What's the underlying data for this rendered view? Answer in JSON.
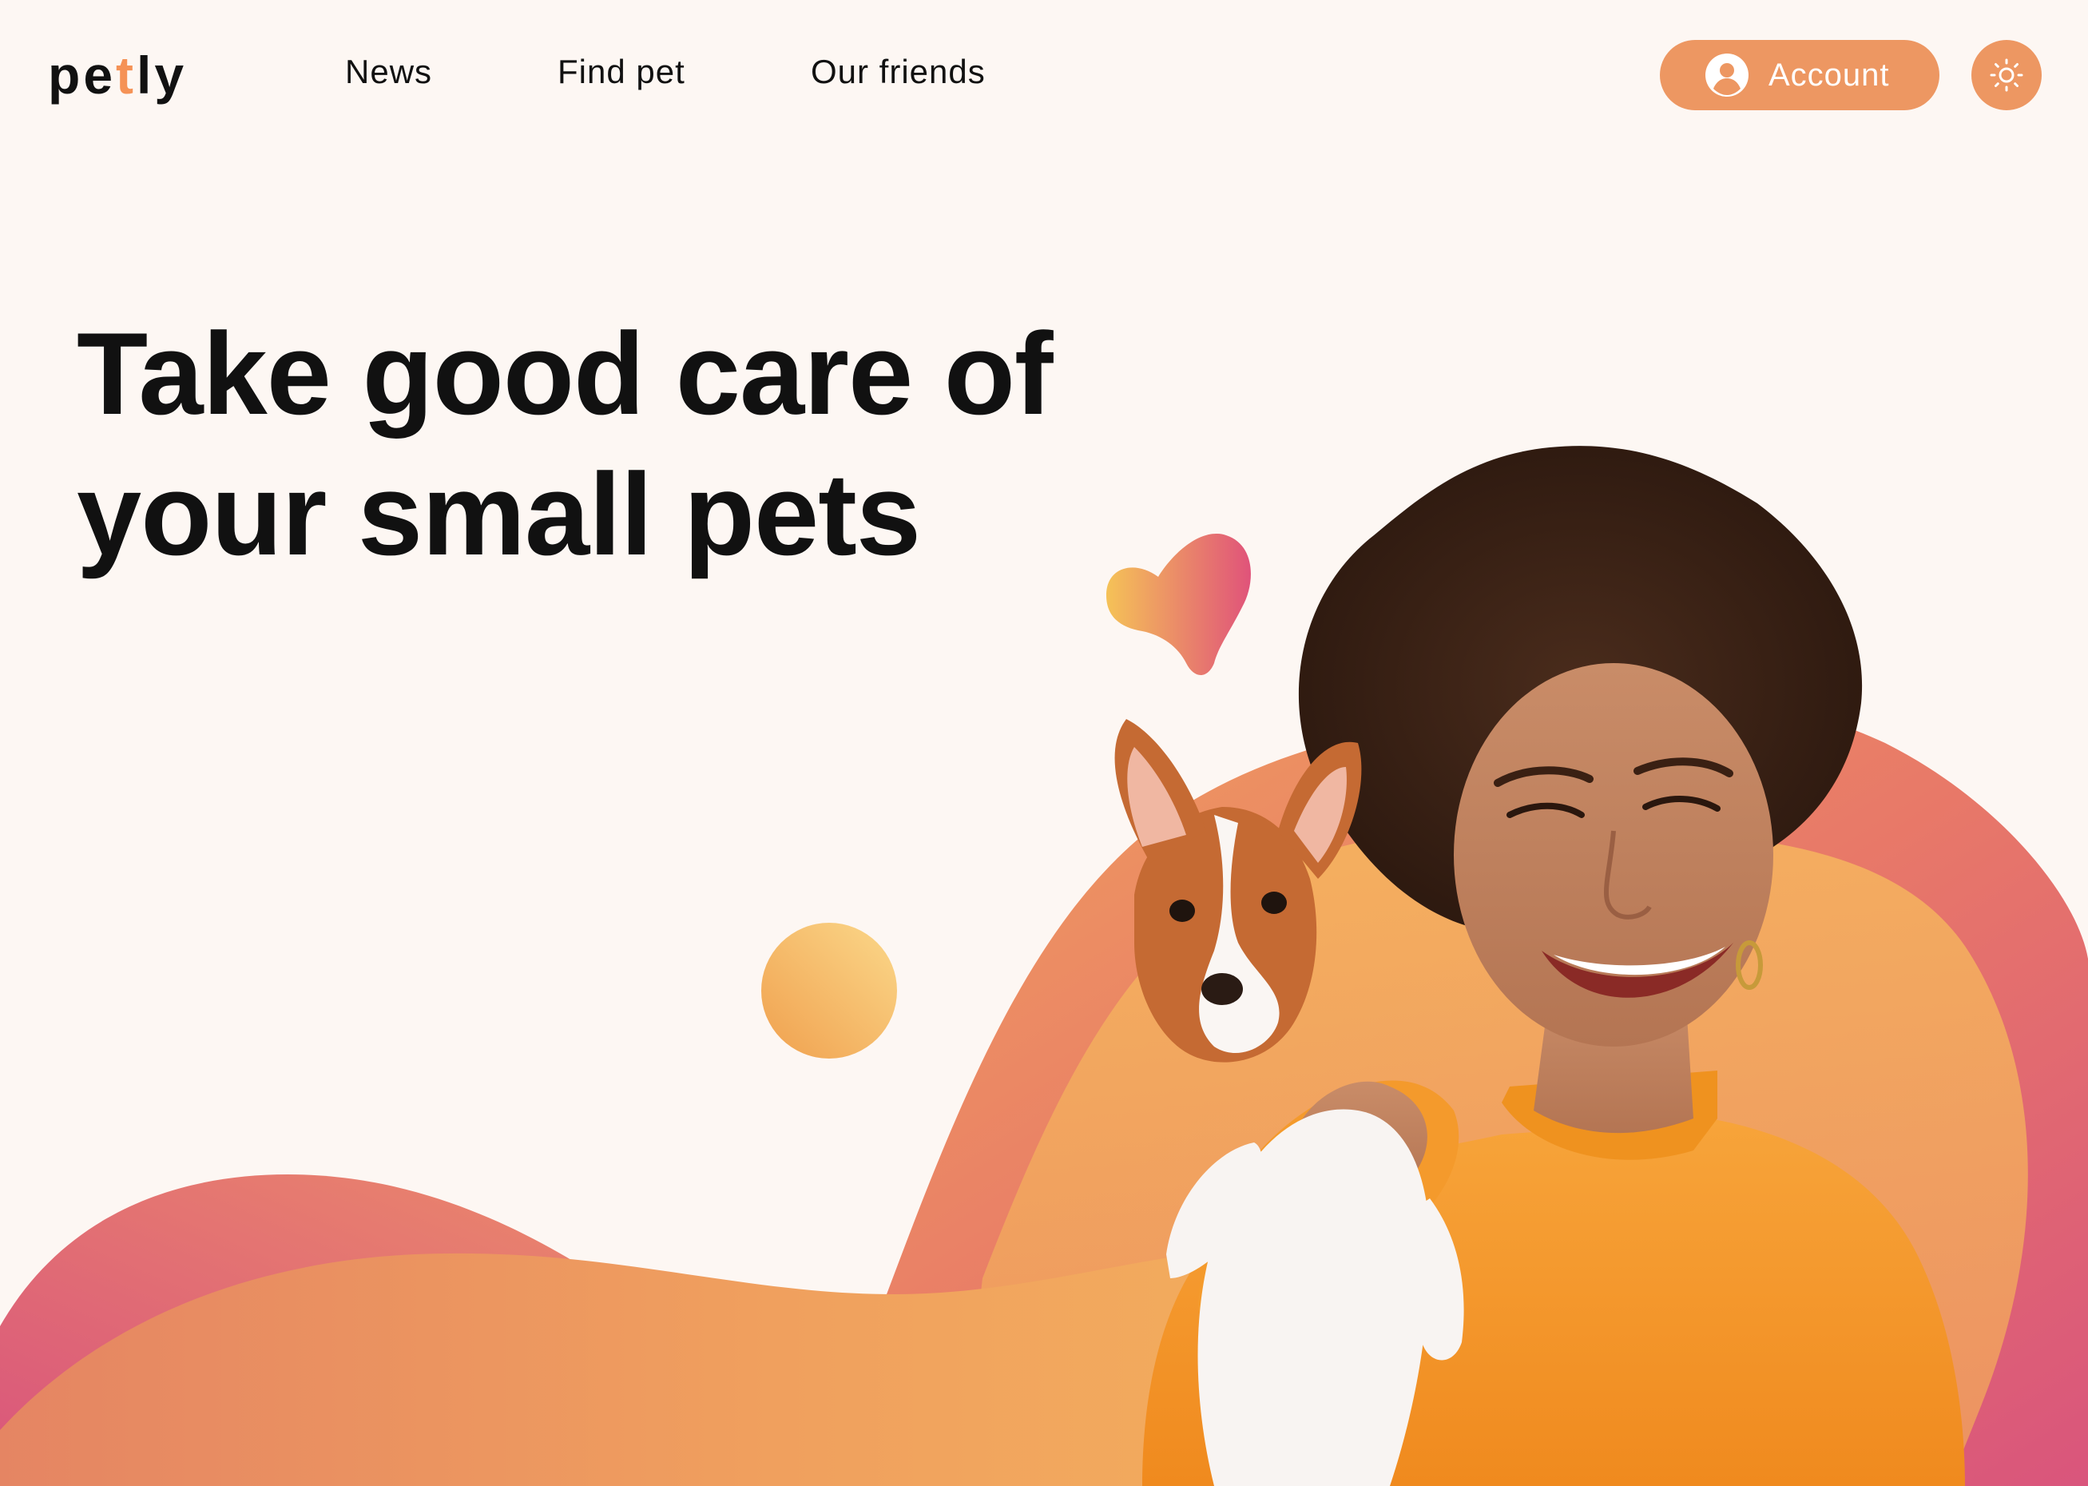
{
  "header": {
    "logo": {
      "part1": "pe",
      "part2": "t",
      "part3": "ly"
    },
    "nav": [
      {
        "label": "News"
      },
      {
        "label": "Find pet"
      },
      {
        "label": "Our friends"
      }
    ],
    "account": {
      "label": "Account",
      "icon": "user-circle-icon"
    },
    "theme_toggle": {
      "icon": "sun-icon"
    }
  },
  "hero": {
    "title_line1": "Take good care of",
    "title_line2": "your small pets",
    "image": "woman-holding-puppy"
  },
  "colors": {
    "background": "#fdf7f3",
    "accent": "#f59256",
    "button": "#ed9762",
    "wave_pink": "#db5a7a",
    "wave_orange": "#f0a060",
    "text": "#111111"
  }
}
